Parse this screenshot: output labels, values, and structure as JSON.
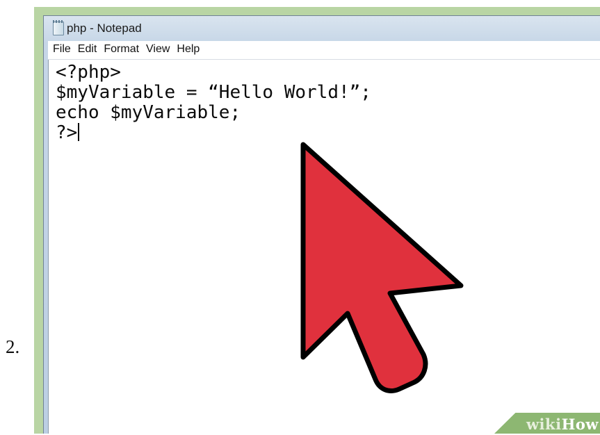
{
  "step_number": "2.",
  "window": {
    "title": "php - Notepad",
    "icon": "notepad-icon"
  },
  "menu": [
    "File",
    "Edit",
    "Format",
    "View",
    "Help"
  ],
  "editor": {
    "lines": [
      "<?php>",
      "$myVariable = “Hello World!”;",
      "echo $myVariable;",
      "?>"
    ]
  },
  "cursor_graphic": {
    "icon": "mouse-pointer-arrow-icon",
    "color": "#e0313d"
  },
  "watermark": {
    "part1": "wiki",
    "part2": "How",
    "color": "#8db772"
  },
  "colors": {
    "frame_green": "#b9d5a4",
    "titlebar": "#c6d6e7"
  }
}
